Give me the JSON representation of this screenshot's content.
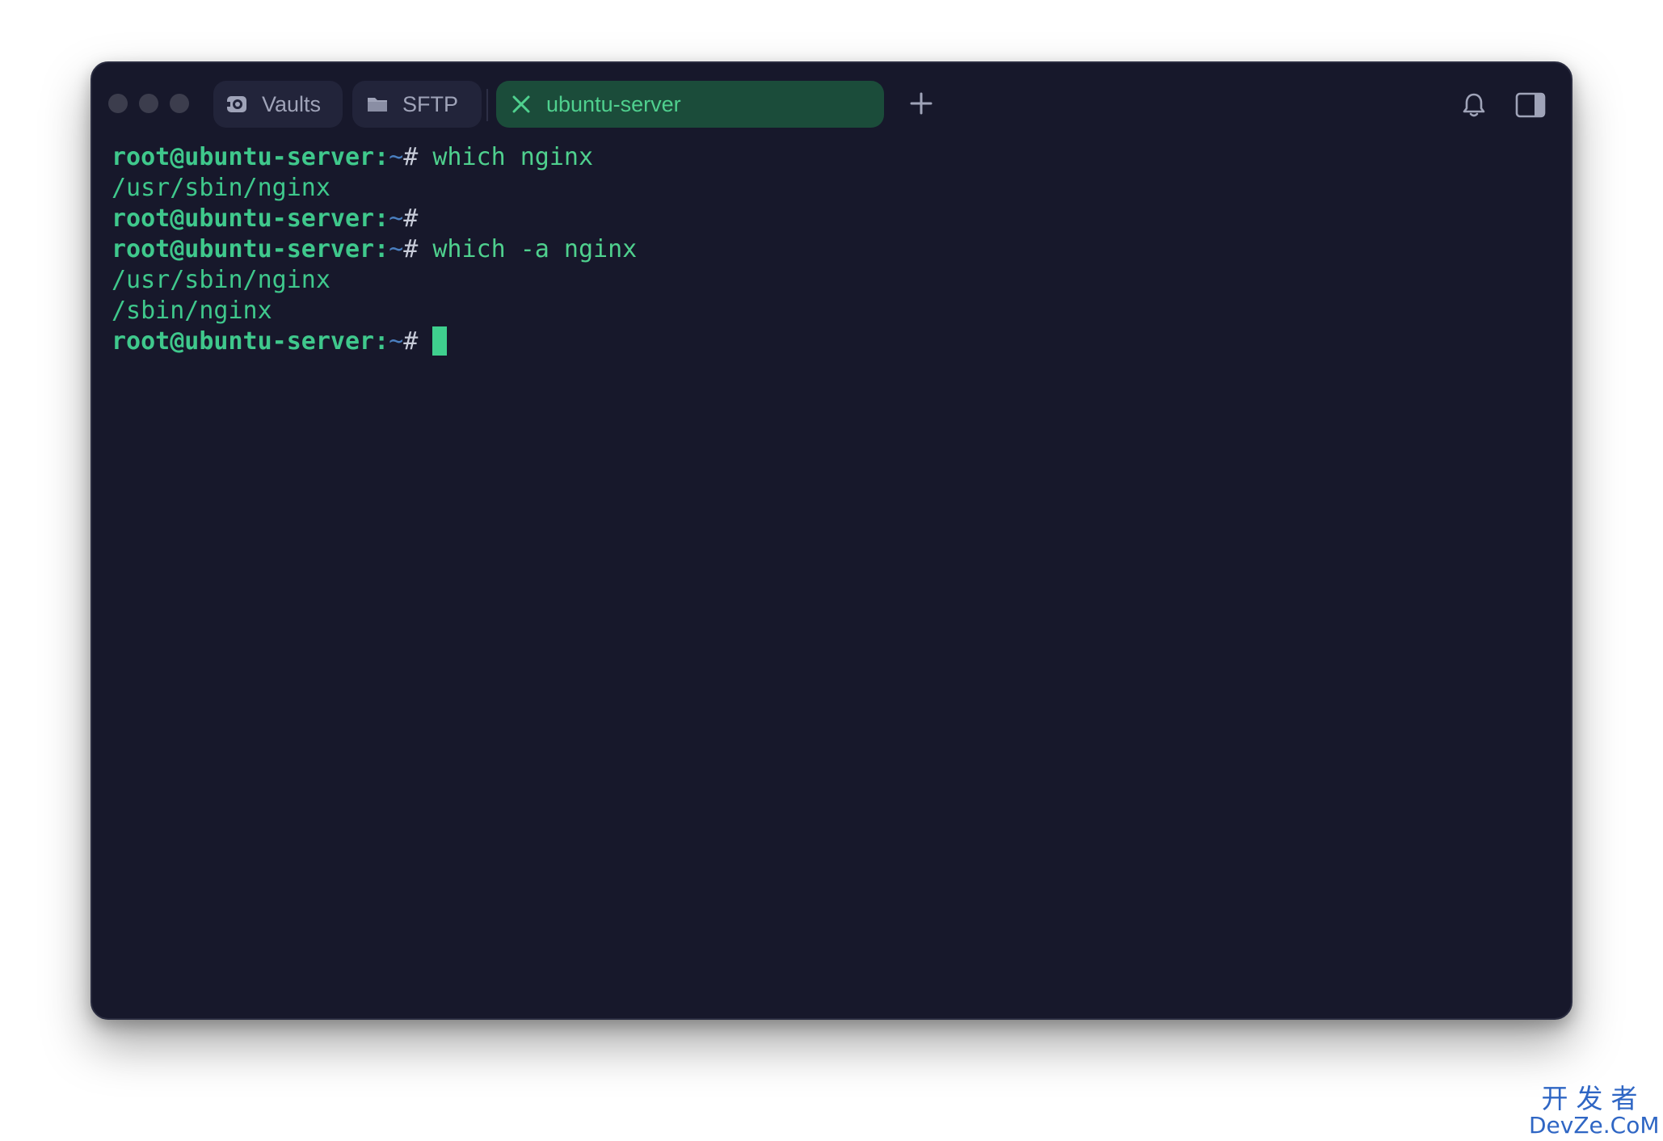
{
  "tabs": [
    {
      "label": "Vaults",
      "icon": "vault-icon",
      "active": false
    },
    {
      "label": "SFTP",
      "icon": "folder-icon",
      "active": false
    },
    {
      "label": "ubuntu-server",
      "icon": "terminal-x-icon",
      "active": true
    }
  ],
  "toolbar": {
    "add_tab_icon": "plus-icon",
    "notifications_icon": "bell-icon",
    "sidebar_icon": "side-panel-icon"
  },
  "terminal": {
    "prompt_user": "root@ubuntu-server",
    "prompt_colon": ":",
    "prompt_path": "~",
    "prompt_hash": "#",
    "lines": [
      {
        "type": "prompt",
        "command": "which nginx"
      },
      {
        "type": "output",
        "text": "/usr/sbin/nginx"
      },
      {
        "type": "prompt",
        "command": ""
      },
      {
        "type": "prompt",
        "command": "which -a nginx"
      },
      {
        "type": "output",
        "text": "/usr/sbin/nginx"
      },
      {
        "type": "output",
        "text": "/sbin/nginx"
      },
      {
        "type": "prompt",
        "command": "",
        "cursor": true
      }
    ]
  },
  "watermark": {
    "cn": "开发者",
    "en": "DevZe.CoM"
  },
  "colors": {
    "background": "#17182b",
    "accent_green": "#3fcf8e",
    "active_tab_bg": "#1b4c3a",
    "prompt_path": "#4a7fc0"
  }
}
